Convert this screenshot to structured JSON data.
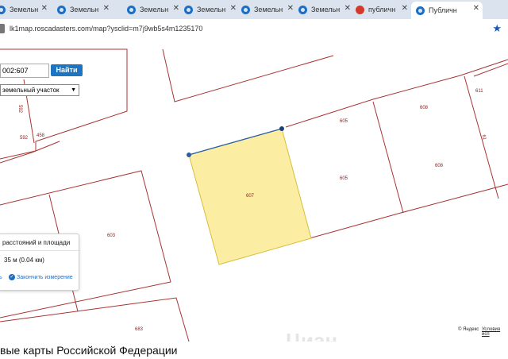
{
  "browser": {
    "tabs": [
      {
        "label": "Земельн",
        "icon": "globe-icon"
      },
      {
        "label": "Земельн",
        "icon": "globe-icon"
      },
      {
        "label": "Земельн",
        "icon": "globe-icon"
      },
      {
        "label": "Земельн",
        "icon": "globe-icon"
      },
      {
        "label": "Земельн",
        "icon": "globe-icon"
      },
      {
        "label": "Земельн",
        "icon": "globe-icon"
      },
      {
        "label": "публичн",
        "icon": "yandex-icon"
      },
      {
        "label": "Публичн",
        "icon": "globe-icon"
      }
    ],
    "close_glyph": "✕",
    "url": "lk1map.roscadasters.com/map?ysclid=m7j9wb5s4m1235170"
  },
  "search": {
    "value": "002:607",
    "button_label": "Найти",
    "type_selected": "земельный участок"
  },
  "parcels": {
    "labels": [
      "592",
      "458",
      "592",
      "605",
      "608",
      "611",
      "605",
      "608",
      "61",
      "607",
      "603",
      "683"
    ]
  },
  "measure": {
    "title": "расстояний и площади",
    "value": "35 м (0.04 км)",
    "link_left": "ь",
    "link_finish": "Закончить измерение"
  },
  "map_footer": {
    "yandex": "© Яндекс",
    "terms": "Условия исп",
    "watermark": "Циан"
  },
  "page": {
    "heading": "вые карты Российской Федерации"
  }
}
